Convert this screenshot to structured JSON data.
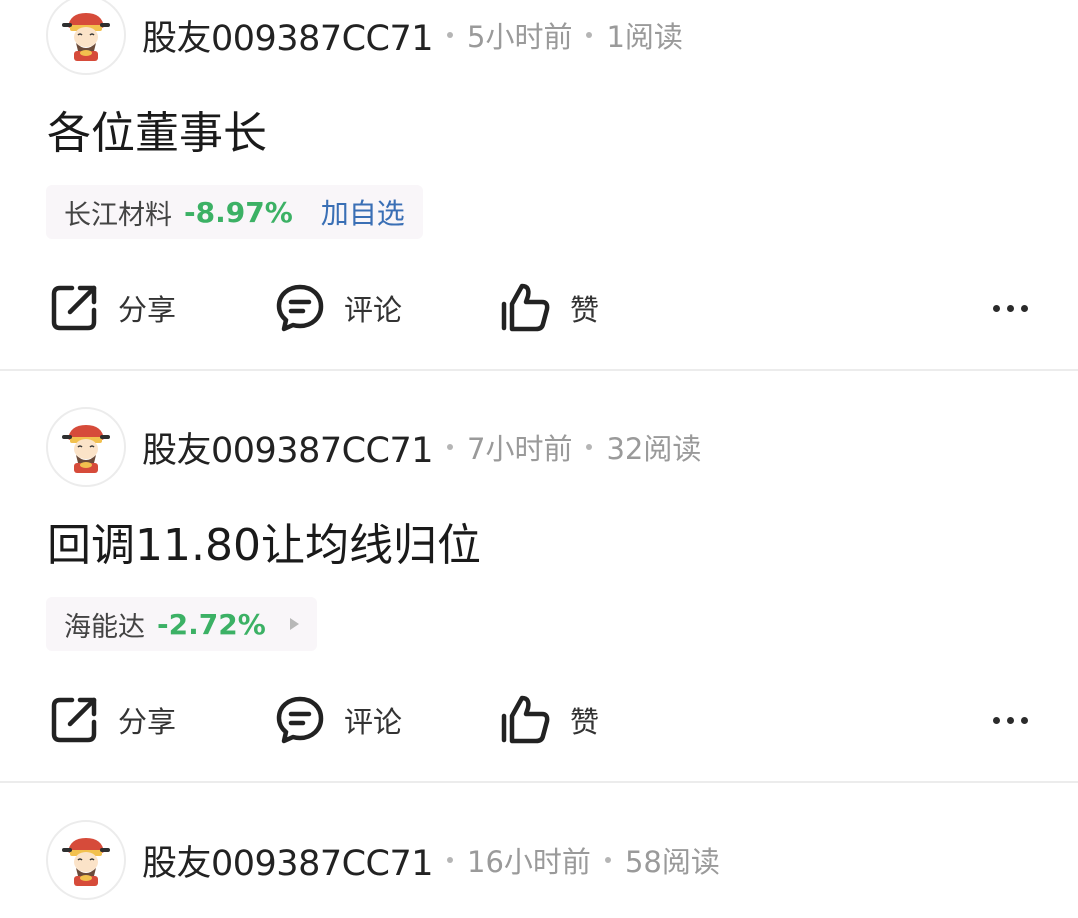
{
  "posts": [
    {
      "username": "股友009387CC71",
      "time": "5小时前",
      "reads": "1阅读",
      "title": "各位董事长",
      "stock": {
        "name": "长江材料",
        "change": "-8.97%",
        "action": "加自选"
      },
      "actions": {
        "share": "分享",
        "comment": "评论",
        "like": "赞"
      }
    },
    {
      "username": "股友009387CC71",
      "time": "7小时前",
      "reads": "32阅读",
      "title": "回调11.80让均线归位",
      "stock": {
        "name": "海能达",
        "change": "-2.72%"
      },
      "actions": {
        "share": "分享",
        "comment": "评论",
        "like": "赞"
      }
    },
    {
      "username": "股友009387CC71",
      "time": "16小时前",
      "reads": "58阅读"
    }
  ],
  "colors": {
    "change_down": "#3cb165",
    "link": "#3a6fb5",
    "meta": "#9a9a9a",
    "tag_bg": "#f9f6f9"
  },
  "icons": {
    "avatar": "caishen-avatar-icon",
    "share": "share-icon",
    "comment": "comment-icon",
    "like": "thumbs-up-icon",
    "more": "more-dots-icon",
    "tag_arrow": "play-arrow-icon"
  }
}
